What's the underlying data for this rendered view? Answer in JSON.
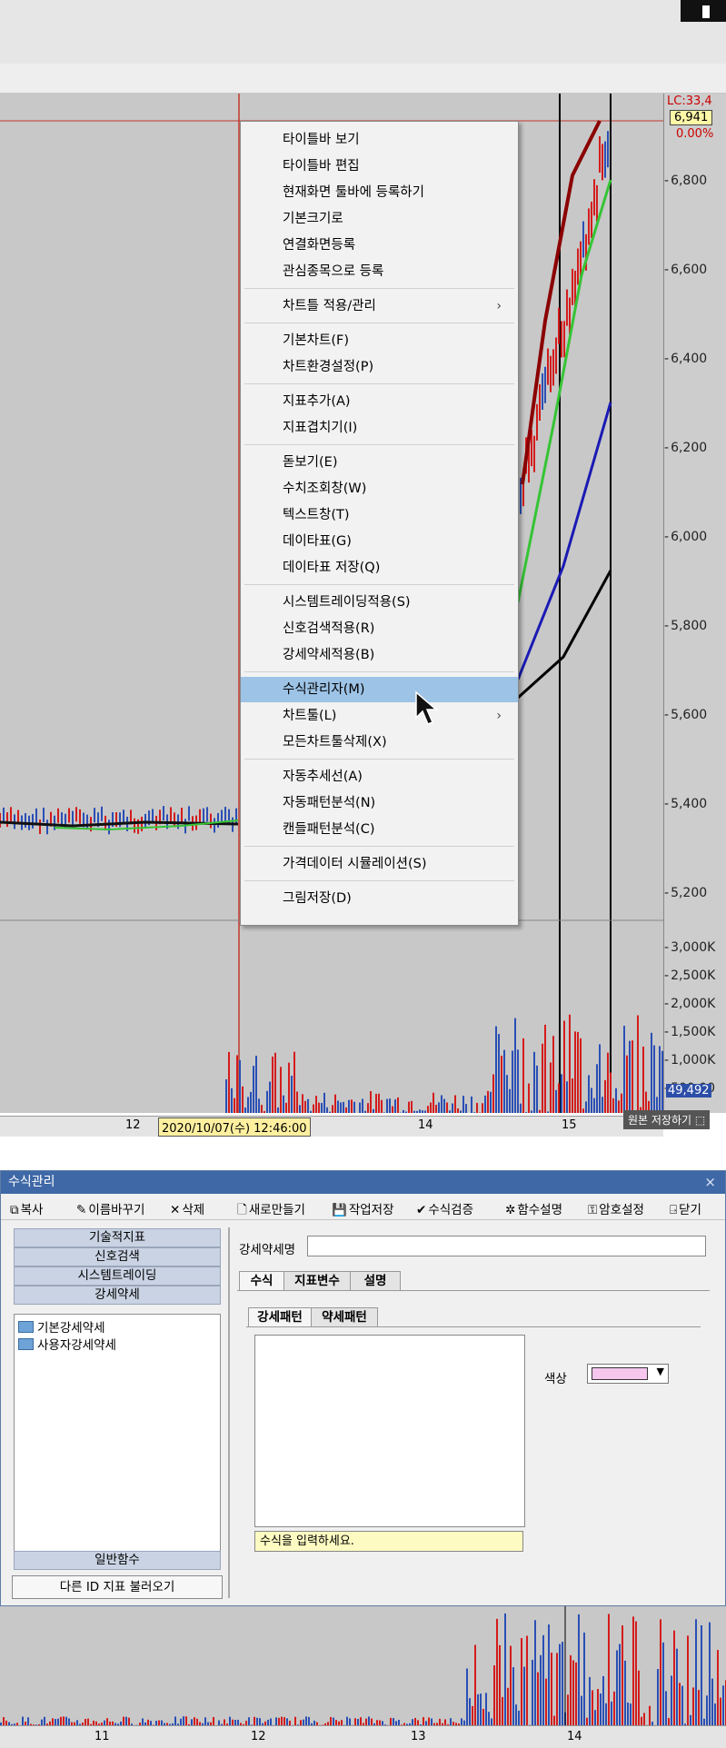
{
  "app": {
    "colors": {
      "hover_highlight": "#9dc3e6",
      "dialog_title_bg": "#3f68a7",
      "candle_up": "#d41c1c",
      "candle_down": "#2a4fb5"
    }
  },
  "chart_top": {
    "lc_label": "LC:33,4",
    "current_price": "6,941",
    "percent_label": "0.00%",
    "price_ticks": [
      "6,800",
      "6,600",
      "6,400",
      "6,200",
      "6,000",
      "5,800",
      "5,600",
      "5,400",
      "5,200"
    ],
    "volume_ticks": [
      "3,000K",
      "2,500K",
      "2,000K",
      "1,500K",
      "1,000K",
      "500,00"
    ],
    "volume_badge": "49,492",
    "date_ticks": [
      "12",
      "14",
      "15"
    ],
    "crosshair_date": "2020/10/07(수) 12:46:00",
    "save_tooltip": "원본 저장하기 ⬚"
  },
  "context_menu": {
    "items": [
      {
        "label": "타이틀바 보기"
      },
      {
        "label": "타이틀바 편집"
      },
      {
        "label": "현재화면 툴바에 등록하기"
      },
      {
        "label": "기본크기로"
      },
      {
        "label": "연결화면등록"
      },
      {
        "label": "관심종목으로 등록"
      },
      {
        "label": "차트틀 적용/관리",
        "submenu": true
      },
      {
        "label": "기본차트(F)"
      },
      {
        "label": "차트환경설정(P)"
      },
      {
        "label": "지표추가(A)"
      },
      {
        "label": "지표겹치기(I)"
      },
      {
        "label": "돋보기(E)"
      },
      {
        "label": "수치조회창(W)"
      },
      {
        "label": "텍스트창(T)"
      },
      {
        "label": "데이타표(G)"
      },
      {
        "label": "데이타표 저장(Q)"
      },
      {
        "label": "시스템트레이딩적용(S)"
      },
      {
        "label": "신호검색적용(R)"
      },
      {
        "label": "강세약세적용(B)"
      },
      {
        "label": "수식관리자(M)",
        "highlighted": true
      },
      {
        "label": "차트툴(L)",
        "submenu": true
      },
      {
        "label": "모든차트툴삭제(X)"
      },
      {
        "label": "자동추세선(A)"
      },
      {
        "label": "자동패턴분석(N)"
      },
      {
        "label": "캔들패턴분석(C)"
      },
      {
        "label": "가격데이터 시뮬레이션(S)"
      },
      {
        "label": "그림저장(D)"
      }
    ],
    "submenu_arrow": "›"
  },
  "dialog": {
    "title": "수식관리",
    "close": "×",
    "toolbar": [
      {
        "label": "복사",
        "icon": "copy-icon",
        "glyph": "⧉"
      },
      {
        "label": "이름바꾸기",
        "icon": "rename-icon",
        "glyph": "✎"
      },
      {
        "label": "삭제",
        "icon": "delete-icon",
        "glyph": "✕"
      },
      {
        "label": "새로만들기",
        "icon": "new-file-icon",
        "glyph": "🗋"
      },
      {
        "label": "작업저장",
        "icon": "save-icon",
        "glyph": "💾"
      },
      {
        "label": "수식검증",
        "icon": "check-icon",
        "glyph": "✔"
      },
      {
        "label": "함수설명",
        "icon": "function-help-icon",
        "glyph": "✲"
      },
      {
        "label": "암호설정",
        "icon": "key-icon",
        "glyph": "⚿"
      },
      {
        "label": "닫기",
        "icon": "exit-icon",
        "glyph": "⍈"
      }
    ],
    "categories": [
      "기술적지표",
      "신호검색",
      "시스템트레이딩",
      "강세약세"
    ],
    "tree": [
      "기본강세약세",
      "사용자강세약세"
    ],
    "bottom_category": "일반함수",
    "import_button": "다른 ID 지표 불러오기",
    "name_label": "강세약세명",
    "name_value": "",
    "tabs": [
      "수식",
      "지표변수",
      "설명"
    ],
    "subtabs": [
      "강세패턴",
      "약세패턴"
    ],
    "hint": "수식을 입력하세요.",
    "color_label": "색상",
    "color_value": "#f6c6ee"
  },
  "chart_bottom": {
    "date_ticks": [
      "11",
      "12",
      "13",
      "14"
    ]
  }
}
